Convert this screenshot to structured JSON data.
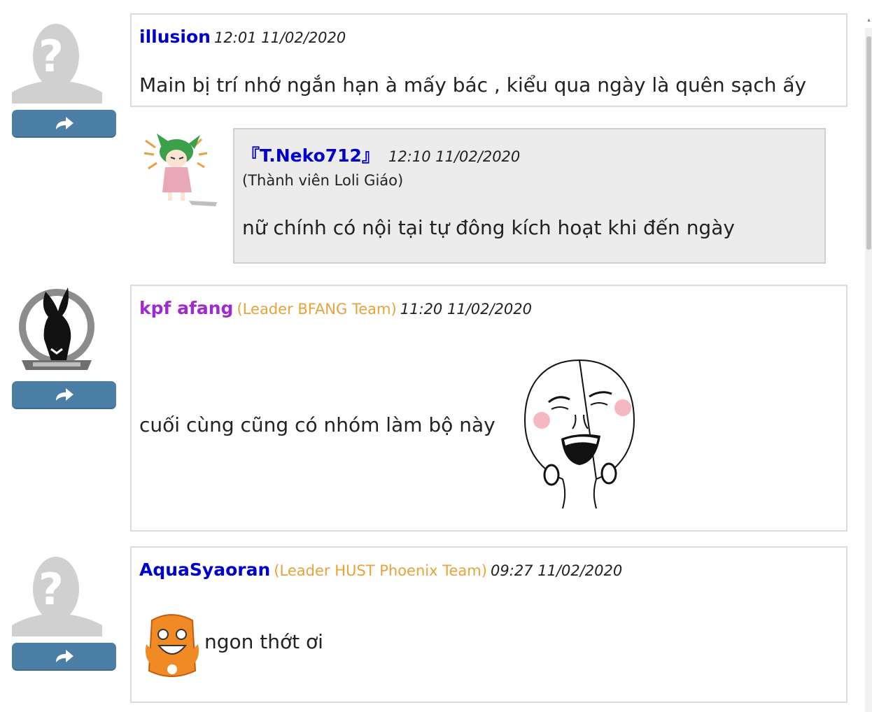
{
  "comments": [
    {
      "username": "illusion",
      "time": "12:01 11/02/2020",
      "content": "Main bị trí nhớ ngắn hạn à mấy bác , kiểu qua ngày là quên sạch ấy",
      "avatar_icon": "default-user-silhouette",
      "reply": {
        "username": "『T.Neko712』",
        "time": "12:10 11/02/2020",
        "member_note": "(Thành viên Loli Giáo)",
        "content": "nữ chính có nội tại tự đông kích hoạt khi đến ngày",
        "avatar_icon": "anime-cat-girl"
      }
    },
    {
      "username": "kpf afang",
      "team": "(Leader BFANG Team)",
      "time": "11:20 11/02/2020",
      "content": "cuối cùng cũng có nhóm làm bộ này",
      "avatar_icon": "bunny-emblem",
      "sticker": "laughing-face-meme"
    },
    {
      "username": "AquaSyaoran",
      "team": "(Leader HUST Phoenix Team)",
      "time": "09:27 11/02/2020",
      "content": "ngon thớt ơi",
      "avatar_icon": "default-user-silhouette",
      "sticker": "orange-onion-emoji"
    }
  ],
  "reply_icon": "share-arrow-icon",
  "colors": {
    "username_blue": "#0000cc",
    "username_purple": "#a02ad0",
    "team_orange": "#e8a23a",
    "reply_button": "#4a7ea5"
  }
}
